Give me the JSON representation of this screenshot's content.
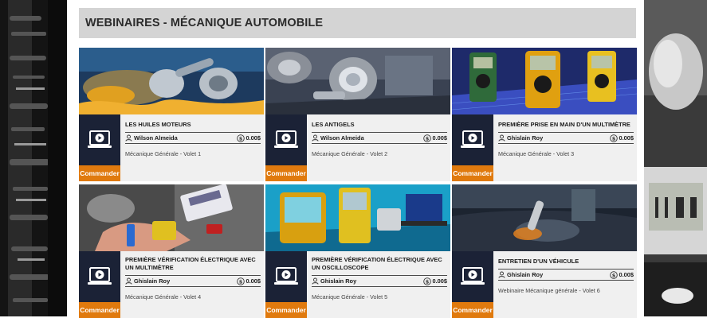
{
  "page": {
    "title": "WEBINAIRES - MÉCANIQUE AUTOMOBILE"
  },
  "colors": {
    "accent": "#e07a0e",
    "icon_bg": "#1b2236",
    "header_bg": "#d4d4d4",
    "card_bg": "#f0f0f0"
  },
  "cards": [
    {
      "title": "LES HUILES MOTEURS",
      "author": "Wilson Almeida",
      "price": "0.00$",
      "description": "Mécanique Générale - Volet 1",
      "button": "Commander",
      "image": "engine-oil-photo"
    },
    {
      "title": "LES ANTIGELS",
      "author": "Wilson Almeida",
      "price": "0.00$",
      "description": "Mécanique Générale - Volet 2",
      "button": "Commander",
      "image": "antifreeze-photo"
    },
    {
      "title": "PREMIÈRE PRISE EN MAIN D'UN MULTIMÈTRE",
      "author": "Ghislain Roy",
      "price": "0.00$",
      "description": "Mécanique Générale - Volet 3",
      "button": "Commander",
      "image": "multimeters-photo"
    },
    {
      "title": "PREMIÈRE VÉRIFICATION ÉLECTRIQUE AVEC UN MULTIMÈTRE",
      "author": "Ghislain Roy",
      "price": "0.00$",
      "description": "Mécanique Générale - Volet 4",
      "button": "Commander",
      "image": "battery-test-photo"
    },
    {
      "title": "PREMIÈRE VÉRIFICATION ÉLECTRIQUE AVEC UN OSCILLOSCOPE",
      "author": "Ghislain Roy",
      "price": "0.00$",
      "description": "Mécanique Générale - Volet 5",
      "button": "Commander",
      "image": "oscilloscope-photo"
    },
    {
      "title": "ENTRETIEN D'UN VÉHICULE",
      "author": "Ghislain Roy",
      "price": "0.00$",
      "description": "Webinaire Mécanique générale - Volet 6",
      "button": "Commander",
      "image": "vehicle-maintenance-photo"
    }
  ]
}
